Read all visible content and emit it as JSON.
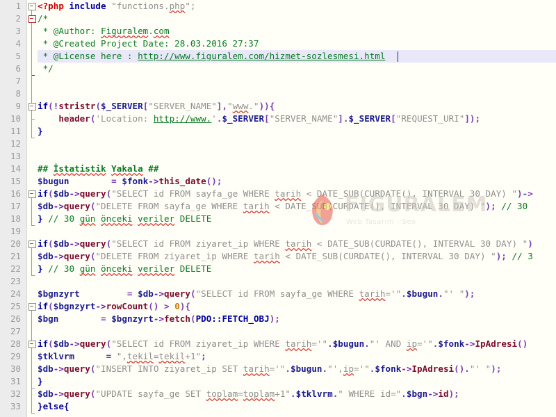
{
  "editor": {
    "language": "PHP",
    "font_size_px": 12.6,
    "line_height_px": 18,
    "gutter_bg": "#ececec",
    "code_bg": "#fffef7",
    "current_line_bg": "#e8e8f8",
    "line_number_color": "#9a9a9a",
    "total_visible_lines": 33,
    "caret_line": 5
  },
  "watermark": {
    "brand": "FIGURALEM",
    "tagline": "Web Tasarım - Seo",
    "color": "#cfc8bd",
    "logo_icon": "figuralem-logo-icon"
  },
  "colors": {
    "keyword": "#00009f",
    "php_tag": "#cc0000",
    "string": "#8f8f8f",
    "variable": "#1b1b8f",
    "function": "#7a0b2e",
    "comment": "#0a7a24",
    "operator": "#6a1fa8",
    "number": "#c87800",
    "punctuation": "#7a3fb0",
    "spell_error_underline": "#d63a2f"
  },
  "line_numbers": [
    "1",
    "2",
    "3",
    "4",
    "5",
    "6",
    "7",
    "8",
    "9",
    "10",
    "11",
    "12",
    "13",
    "14",
    "15",
    "16",
    "17",
    "18",
    "19",
    "20",
    "21",
    "22",
    "23",
    "24",
    "25",
    "26",
    "27",
    "28",
    "29",
    "30",
    "31",
    "32",
    "33"
  ],
  "code_lines": [
    {
      "n": 1,
      "text": "<?php include \"functions.php\";"
    },
    {
      "n": 2,
      "text": "/*"
    },
    {
      "n": 3,
      "text": " * @Author: Figuralem.com"
    },
    {
      "n": 4,
      "text": " * @Created Project Date: 28.03.2016 27:37"
    },
    {
      "n": 5,
      "text": " * @License here : http://www.figuralem.com/hizmet-sozlesmesi.html"
    },
    {
      "n": 6,
      "text": " */"
    },
    {
      "n": 7,
      "text": ""
    },
    {
      "n": 8,
      "text": ""
    },
    {
      "n": 9,
      "text": "if(!stristr($_SERVER[\"SERVER_NAME\"],\"www.\")){"
    },
    {
      "n": 10,
      "text": "    header('Location: http://www.'.$_SERVER[\"SERVER_NAME\"].$_SERVER[\"REQUEST_URI\"]);"
    },
    {
      "n": 11,
      "text": "}"
    },
    {
      "n": 12,
      "text": ""
    },
    {
      "n": 13,
      "text": ""
    },
    {
      "n": 14,
      "text": "## İstatistik Yakala ##"
    },
    {
      "n": 15,
      "text": "$bugun        = $fonk->this_date();"
    },
    {
      "n": 16,
      "text": "if($db->query(\"SELECT id FROM sayfa_ge WHERE tarih < DATE_SUB(CURDATE(), INTERVAL 30 DAY) \")->"
    },
    {
      "n": 17,
      "text": "$db->query(\"DELETE FROM sayfa_ge WHERE tarih < DATE_SUB(CURDATE(), INTERVAL 30 DAY) \"); // 30"
    },
    {
      "n": 18,
      "text": "} // 30 gün önceki veriler DELETE"
    },
    {
      "n": 19,
      "text": ""
    },
    {
      "n": 20,
      "text": "if($db->query(\"SELECT id FROM ziyaret_ip WHERE tarih < DATE_SUB(CURDATE(), INTERVAL 30 DAY) \")"
    },
    {
      "n": 21,
      "text": "$db->query(\"DELETE FROM ziyaret_ip WHERE tarih < DATE_SUB(CURDATE(), INTERVAL 30 DAY) \"); // 3"
    },
    {
      "n": 22,
      "text": "} // 30 gün önceki veriler DELETE"
    },
    {
      "n": 23,
      "text": ""
    },
    {
      "n": 24,
      "text": "$bgnzyrt         = $db->query(\"SELECT id FROM sayfa_ge WHERE tarih='\".$bugun.\"' \");"
    },
    {
      "n": 25,
      "text": "if($bgnzyrt->rowCount() > 0){"
    },
    {
      "n": 26,
      "text": "$bgn        = $bgnzyrt->fetch(PDO::FETCH_OBJ);"
    },
    {
      "n": 27,
      "text": ""
    },
    {
      "n": 28,
      "text": "if($db->query(\"SELECT id FROM ziyaret_ip WHERE tarih='\".$bugun.\"' AND ip='\".$fonk->IpAdresi()"
    },
    {
      "n": 29,
      "text": "$tklvrm      = \",tekil=tekil+1\";"
    },
    {
      "n": 30,
      "text": "$db->query(\"INSERT INTO ziyaret_ip SET tarih='\".$bugun.\"',ip='\".$fonk->IpAdresi().\"' \");"
    },
    {
      "n": 31,
      "text": "}"
    },
    {
      "n": 32,
      "text": "$db->query(\"UPDATE sayfa_ge SET toplam=toplam+1\".$tklvrm.\" WHERE id=\".$bgn->id);"
    },
    {
      "n": 33,
      "text": "}else{"
    }
  ],
  "fold_markers": [
    {
      "line": 1,
      "state": "expanded",
      "color": "gray"
    },
    {
      "line": 2,
      "state": "expanded",
      "color": "red"
    },
    {
      "line": 9,
      "state": "expanded",
      "color": "gray"
    },
    {
      "line": 16,
      "state": "expanded",
      "color": "gray"
    },
    {
      "line": 20,
      "state": "expanded",
      "color": "gray"
    },
    {
      "line": 25,
      "state": "expanded",
      "color": "gray"
    },
    {
      "line": 28,
      "state": "expanded",
      "color": "gray"
    }
  ]
}
